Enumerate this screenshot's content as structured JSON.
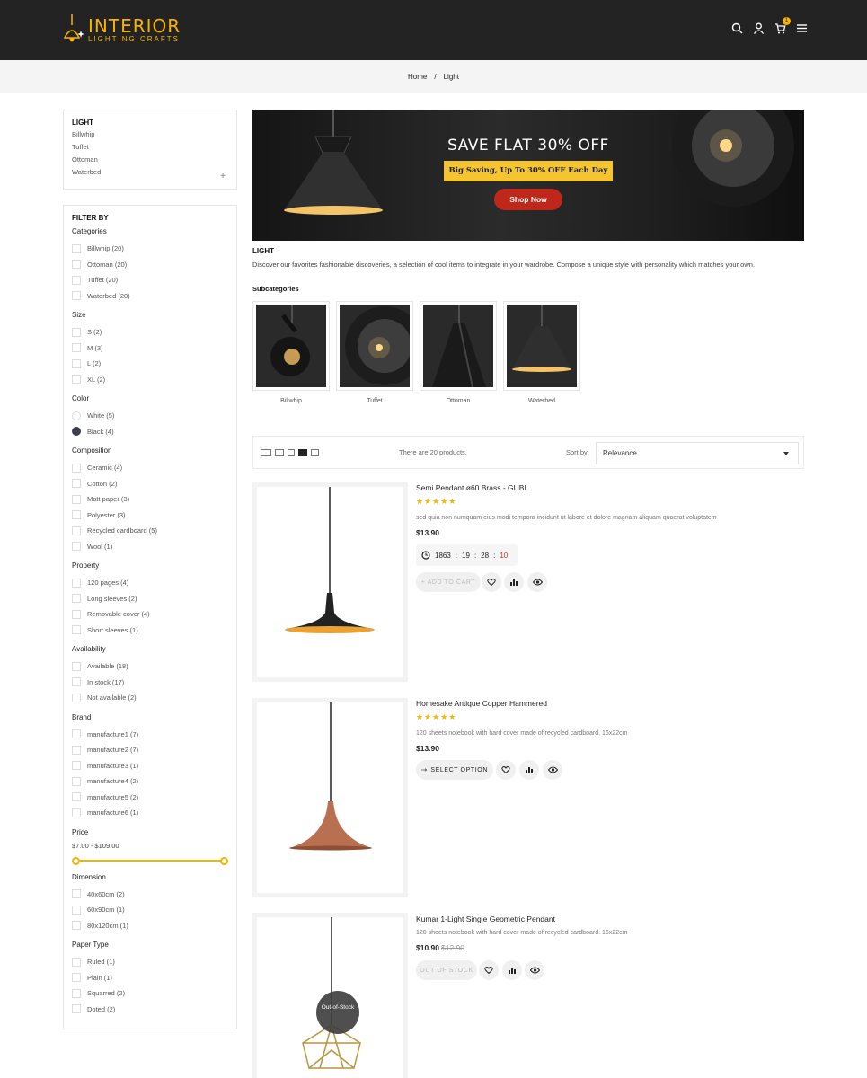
{
  "header": {
    "logo_main": "INTERIOR",
    "logo_sub": "LIGHTING CRAFTS",
    "cart_count": "1",
    "icons": [
      "search-icon",
      "user-icon",
      "cart-icon",
      "menu-icon"
    ]
  },
  "breadcrumb": {
    "home": "Home",
    "sep": "/",
    "current": "Light"
  },
  "category_block": {
    "title": "LIGHT",
    "links": [
      "Billwhip",
      "Tuffet",
      "Ottoman",
      "Waterbed"
    ],
    "expand": "+"
  },
  "filters": {
    "title": "FILTER BY",
    "categories": {
      "title": "Categories",
      "items": [
        "Billwhip (20)",
        "Ottoman (20)",
        "Tuffet (20)",
        "Waterbed (20)"
      ]
    },
    "size": {
      "title": "Size",
      "items": [
        "S (2)",
        "M (3)",
        "L (2)",
        "XL (2)"
      ]
    },
    "color": {
      "title": "Color",
      "items": [
        {
          "label": "White (5)",
          "color": "#ffffff"
        },
        {
          "label": "Black (4)",
          "color": "#3a3f4b"
        }
      ]
    },
    "composition": {
      "title": "Composition",
      "items": [
        "Ceramic (4)",
        "Cotton (2)",
        "Matt paper (3)",
        "Polyester (3)",
        "Recycled cardboard (5)",
        "Wool (1)"
      ]
    },
    "property": {
      "title": "Property",
      "items": [
        "120 pages (4)",
        "Long sleeves (2)",
        "Removable cover (4)",
        "Short sleeves (1)"
      ]
    },
    "availability": {
      "title": "Availability",
      "items": [
        "Available (18)",
        "In stock (17)",
        "Not available (2)"
      ]
    },
    "brand": {
      "title": "Brand",
      "items": [
        "manufacture1 (7)",
        "manufacture2 (7)",
        "manufacture3 (1)",
        "manufacture4 (2)",
        "manufacture5 (2)",
        "manufacture6 (1)"
      ]
    },
    "price": {
      "title": "Price",
      "range": "$7.00 - $109.00",
      "min_fraction": 0,
      "max_fraction": 1
    },
    "dimension": {
      "title": "Dimension",
      "items": [
        "40x60cm (2)",
        "60x90cm (1)",
        "80x120cm (1)"
      ]
    },
    "paper_type": {
      "title": "Paper Type",
      "items": [
        "Ruled (1)",
        "Plain (1)",
        "Squarred (2)",
        "Doted (2)"
      ]
    }
  },
  "banner": {
    "title": "SAVE FLAT 30% OFF",
    "tag": "Big Saving, Up To 30% OFF Each Day",
    "button": "Shop Now"
  },
  "category": {
    "title": "LIGHT",
    "description": "Discover our favorites fashionable discoveries, a selection of cool items to integrate in your wardrobe. Compose a unique style with personality which matches your own.",
    "subcategories_title": "Subcategories",
    "subcategories": [
      "Billwhip",
      "Tuffet",
      "Ottoman",
      "Waterbed"
    ]
  },
  "toolbar": {
    "count": "There are 20 products.",
    "sort_label": "Sort by:",
    "sort_value": "Relevance"
  },
  "products": [
    {
      "name": "Semi Pendant ø60 Brass - GUBI",
      "stars": "★★★★★",
      "description": "sed quia non numquam eius modi tempora incidunt ut labore et dolore magnam aliquam quaerat voluptatem",
      "price": "$13.90",
      "countdown": {
        "days": "1863",
        "hours": "19",
        "minutes": "28",
        "seconds": "10",
        "sep": ":"
      },
      "action": "+ ADD TO CART"
    },
    {
      "name": "Homesake Antique Copper Hammered",
      "stars": "★★★★★",
      "description": "120 sheets notebook with hard cover made of recycled cardboard. 16x22cm",
      "price": "$13.90",
      "action": "SELECT OPTION"
    },
    {
      "name": "Kumar 1-Light Single Geometric Pendant",
      "description": "120 sheets notebook with hard cover made of recycled cardboard. 16x22cm",
      "price": "$10.90",
      "old_price": "$12.90",
      "action": "OUT OF STOCK",
      "badge": "Out-of-Stock"
    }
  ]
}
